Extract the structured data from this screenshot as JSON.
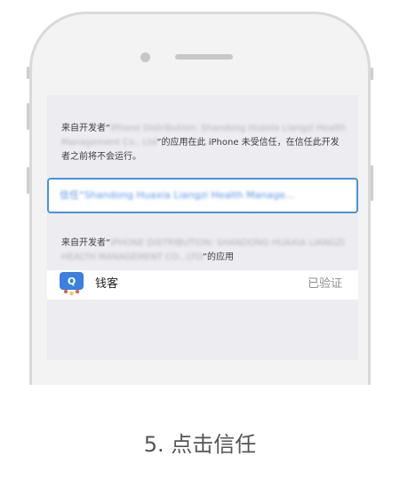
{
  "dialog": {
    "message1_prefix": "来自开发者“",
    "message1_developer": "iPhone Distribution: Shandong Huaxia Liangzi Health Management Co., Ltd",
    "message1_suffix": "”的应用在此 iPhone 未受信任，在信任此开发者之前将不会运行。",
    "trust_button_prefix": "信任“",
    "trust_button_developer": "Shandong Huaxia Liangzi Health Manage...",
    "message2_prefix": "来自开发者“",
    "message2_developer": "IPHONE DISTRIBUTION: SHANDONG HUAXIA LIANGZI HEALTH MANAGEMENT CO., LTD",
    "message2_suffix": "”的应用"
  },
  "app": {
    "name": "钱客",
    "status": "已验证",
    "icon": "qianke-app-icon"
  },
  "caption": "5. 点击信任",
  "colors": {
    "accent": "#4a90e2",
    "frame": "#d9d9d9",
    "screen_bg": "#ececf1"
  }
}
